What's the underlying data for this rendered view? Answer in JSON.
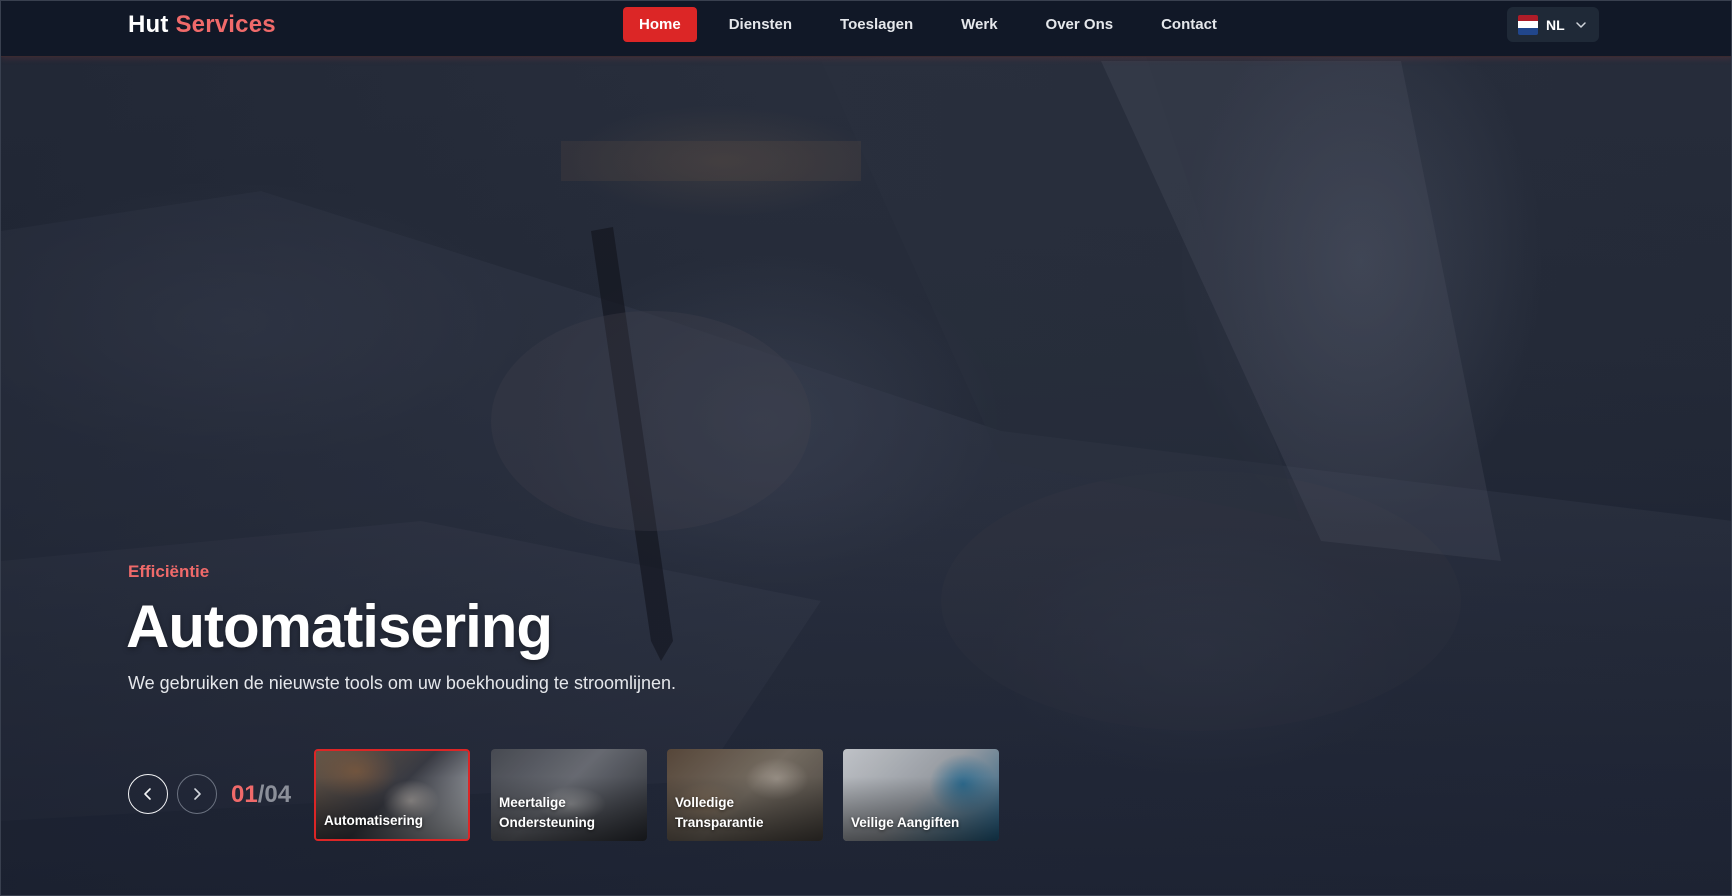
{
  "brand": {
    "name_part1": "Hut",
    "name_part2": "Services",
    "accent": "#dc2626",
    "accent_text": "#f06a6a"
  },
  "nav": {
    "items": [
      {
        "label": "Home",
        "active": true
      },
      {
        "label": "Diensten"
      },
      {
        "label": "Toeslagen"
      },
      {
        "label": "Werk"
      },
      {
        "label": "Over Ons"
      },
      {
        "label": "Contact"
      }
    ]
  },
  "language": {
    "code": "NL",
    "flag": "netherlands-flag-icon",
    "dropdown_icon": "chevron-down-icon"
  },
  "hero": {
    "eyebrow": "Efficiëntie",
    "title": "Automatisering",
    "description": "We gebruiken de nieuwste tools om uw boekhouding te stroomlijnen."
  },
  "slider": {
    "current": "01",
    "total": "/04",
    "prev_icon": "chevron-left-icon",
    "next_icon": "chevron-right-icon",
    "slides": [
      {
        "label": "Automatisering",
        "active": true
      },
      {
        "label": "Meertalige Ondersteuning"
      },
      {
        "label": "Volledige Transparantie"
      },
      {
        "label": "Veilige Aangiften"
      }
    ]
  }
}
